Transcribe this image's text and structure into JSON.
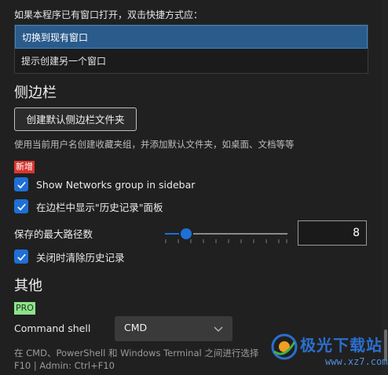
{
  "open_behavior": {
    "label": "如果本程序已有窗口打开，双击快捷方式应：",
    "options": [
      "切换到现有窗口",
      "提示创建另一个窗口"
    ],
    "selected": "切换到现有窗口"
  },
  "sidebar_section": {
    "title": "侧边栏",
    "create_button": "创建默认侧边栏文件夹",
    "description": "使用当前用户名创建收藏夹组，并添加默认文件夹，如桌面、文档等等",
    "new_badge": "新增",
    "show_networks": {
      "label": "Show Networks group in sidebar",
      "checked": true
    },
    "show_history": {
      "label": "在边栏中显示\"历史记录\"面板",
      "checked": true
    },
    "max_paths": {
      "label": "保存的最大路径数",
      "value": "8",
      "slider_fraction": 0.17
    },
    "clear_history": {
      "label": "关闭时清除历史记录",
      "checked": true
    }
  },
  "other_section": {
    "title": "其他",
    "pro_badge": "PRO",
    "command_shell": {
      "label": "Command shell",
      "value": "CMD"
    },
    "hint_line1": "在 CMD、PowerShell 和 Windows Terminal 之间进行选择",
    "hint_line2": "F10 | Admin: Ctrl+F10"
  },
  "watermark": {
    "title": "极光下载站",
    "url": "www.xz7.com"
  },
  "colors": {
    "accent": "#1f6fd6",
    "selected_bg": "#2a5b8b",
    "new_badge": "#d9352f",
    "pro_badge": "#8fe28b"
  }
}
